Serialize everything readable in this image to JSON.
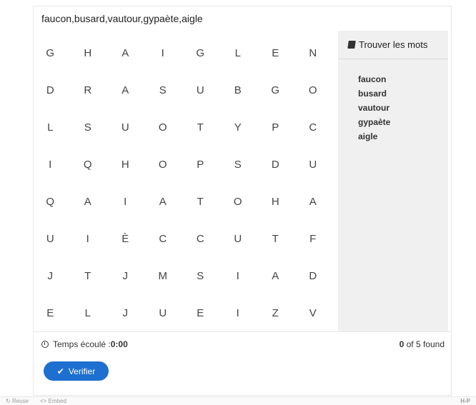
{
  "title": "faucon,busard,vautour,gypaète,aigle",
  "grid": [
    [
      "G",
      "H",
      "A",
      "I",
      "G",
      "L",
      "E",
      "N"
    ],
    [
      "D",
      "R",
      "A",
      "S",
      "U",
      "B",
      "G",
      "O"
    ],
    [
      "L",
      "S",
      "U",
      "O",
      "T",
      "Y",
      "P",
      "C"
    ],
    [
      "I",
      "Q",
      "H",
      "O",
      "P",
      "S",
      "D",
      "U"
    ],
    [
      "Q",
      "A",
      "I",
      "A",
      "T",
      "O",
      "H",
      "A"
    ],
    [
      "U",
      "I",
      "È",
      "C",
      "C",
      "U",
      "T",
      "F"
    ],
    [
      "J",
      "T",
      "J",
      "M",
      "S",
      "I",
      "A",
      "D"
    ],
    [
      "E",
      "L",
      "J",
      "U",
      "E",
      "I",
      "Z",
      "V"
    ]
  ],
  "sidebar": {
    "heading": "Trouver les mots",
    "words": [
      "faucon",
      "busard",
      "vautour",
      "gypaète",
      "aigle"
    ]
  },
  "status": {
    "timer_label": "Temps écoulé : ",
    "timer_value": "0:00",
    "found_count": "0",
    "found_suffix": " of 5 found"
  },
  "button": {
    "label": "Verifier"
  },
  "footer": {
    "reuse": "Reuse",
    "embed": "Embed",
    "hp": "H-P"
  },
  "icons": {
    "book": "book-icon",
    "clock": "clock-icon",
    "check": "checkmark-icon",
    "reuse": "reuse-icon",
    "embed": "embed-icon"
  },
  "colors": {
    "button": "#1d6fd0",
    "sidebar_bg": "#f0f0f0"
  }
}
